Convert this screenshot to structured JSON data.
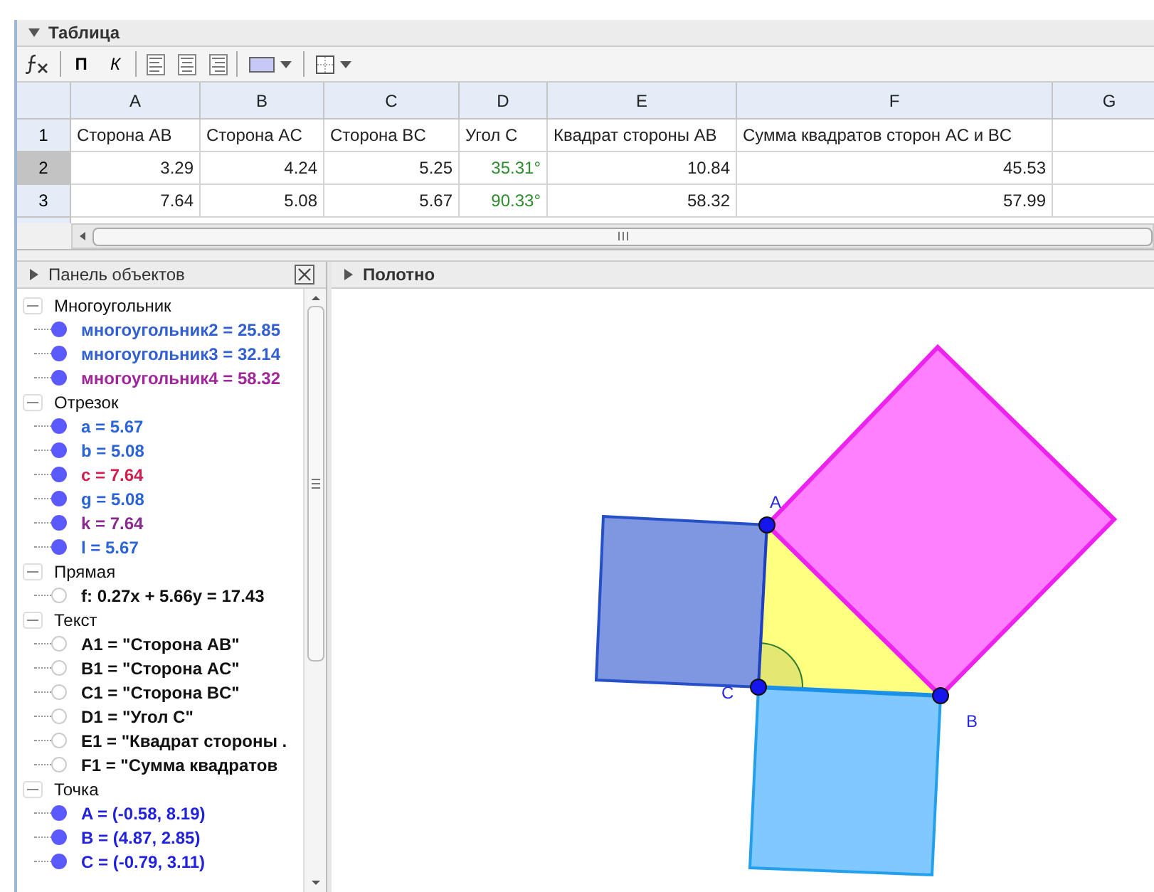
{
  "spreadsheet": {
    "title": "Таблица",
    "expanded": true,
    "toolbar": {
      "bold": "П",
      "italic": "К"
    },
    "columns": [
      "A",
      "B",
      "C",
      "D",
      "E",
      "F",
      "G"
    ],
    "rows": [
      {
        "header": "1",
        "selected": false,
        "kind": "text",
        "cells": [
          "Сторона AB",
          "Сторона AC",
          "Сторона BC",
          "Угол C",
          "Квадрат стороны AB",
          "Сумма квадратов сторон AC и BC"
        ]
      },
      {
        "header": "2",
        "selected": true,
        "kind": "number",
        "cells": [
          "3.29",
          "4.24",
          "5.25",
          {
            "text": "35.31°",
            "color": "#2e8b2e"
          },
          "10.84",
          "45.53"
        ]
      },
      {
        "header": "3",
        "selected": false,
        "kind": "number",
        "cells": [
          "7.64",
          "5.08",
          "5.67",
          {
            "text": "90.33°",
            "color": "#2e8b2e"
          },
          "58.32",
          "57.99"
        ]
      }
    ]
  },
  "object_panel": {
    "title": "Панель объектов",
    "expanded": false,
    "groups": [
      {
        "label": "Многоугольник",
        "expanded": true,
        "children": [
          {
            "text": "многоугольник2 = 25.85",
            "shown": true,
            "color": "#3360d0"
          },
          {
            "text": "многоугольник3 = 32.14",
            "shown": true,
            "color": "#3360d0"
          },
          {
            "text": "многоугольник4 = 58.32",
            "shown": true,
            "color": "#a0269a"
          }
        ]
      },
      {
        "label": "Отрезок",
        "expanded": true,
        "children": [
          {
            "text": "a = 5.67",
            "shown": true,
            "color": "#2a64d6"
          },
          {
            "text": "b = 5.08",
            "shown": true,
            "color": "#2a64d6"
          },
          {
            "text": "c = 7.64",
            "shown": true,
            "color": "#d01f4f"
          },
          {
            "text": "g = 5.08",
            "shown": true,
            "color": "#2a64d6"
          },
          {
            "text": "k = 7.64",
            "shown": true,
            "color": "#8a2a90"
          },
          {
            "text": "l = 5.67",
            "shown": true,
            "color": "#2a64d6"
          }
        ]
      },
      {
        "label": "Прямая",
        "expanded": true,
        "children": [
          {
            "text": "f: 0.27x + 5.66y = 17.43",
            "shown": false,
            "color": "#111111"
          }
        ]
      },
      {
        "label": "Текст",
        "expanded": true,
        "children": [
          {
            "text": "A1 = \"Сторона AB\"",
            "shown": false,
            "color": "#111111"
          },
          {
            "text": "B1 = \"Сторона AC\"",
            "shown": false,
            "color": "#111111"
          },
          {
            "text": "C1 = \"Сторона BC\"",
            "shown": false,
            "color": "#111111"
          },
          {
            "text": "D1 = \"Угол C\"",
            "shown": false,
            "color": "#111111"
          },
          {
            "text": "E1 = \"Квадрат стороны .",
            "shown": false,
            "color": "#111111"
          },
          {
            "text": "F1 = \"Сумма квадратов",
            "shown": false,
            "color": "#111111"
          }
        ]
      },
      {
        "label": "Точка",
        "expanded": true,
        "children": [
          {
            "text": "A = (-0.58, 8.19)",
            "shown": true,
            "color": "#2222dd"
          },
          {
            "text": "B = (4.87, 2.85)",
            "shown": true,
            "color": "#2222dd"
          },
          {
            "text": "C = (-0.79, 3.11)",
            "shown": true,
            "color": "#2222dd"
          }
        ]
      }
    ]
  },
  "graphics": {
    "title": "Полотно",
    "expanded": false,
    "points": [
      "A",
      "B",
      "C"
    ]
  }
}
